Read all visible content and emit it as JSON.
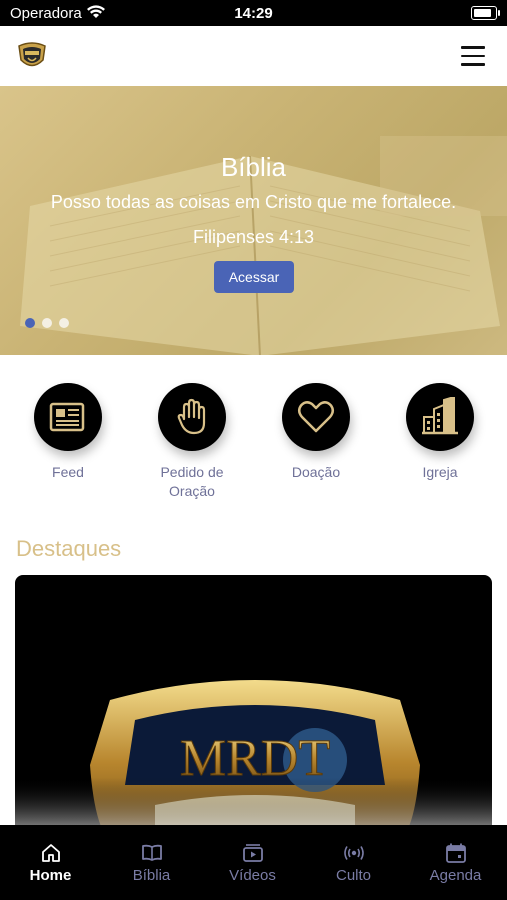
{
  "status_bar": {
    "carrier": "Operadora",
    "time": "14:29"
  },
  "header": {
    "logo_icon": "church-crest-logo",
    "menu_icon": "hamburger-menu-icon"
  },
  "hero": {
    "title": "Bíblia",
    "text": "Posso todas as coisas em Cristo que me fortalece.",
    "reference": "Filipenses 4:13",
    "button_label": "Acessar",
    "slide_count": 3,
    "active_slide": 1
  },
  "quick_actions": [
    {
      "label": "Feed",
      "icon": "newspaper-icon"
    },
    {
      "label": "Pedido de\nOração",
      "icon": "raised-hand-icon"
    },
    {
      "label": "Doação",
      "icon": "heart-icon"
    },
    {
      "label": "Igreja",
      "icon": "buildings-icon"
    }
  ],
  "highlights": {
    "title": "Destaques",
    "card_text": "MRDT"
  },
  "bottom_nav": [
    {
      "label": "Home",
      "icon": "home-icon",
      "active": true
    },
    {
      "label": "Bíblia",
      "icon": "book-icon",
      "active": false
    },
    {
      "label": "Vídeos",
      "icon": "video-icon",
      "active": false
    },
    {
      "label": "Culto",
      "icon": "broadcast-icon",
      "active": false
    },
    {
      "label": "Agenda",
      "icon": "calendar-icon",
      "active": false
    }
  ],
  "colors": {
    "accent": "#4a64b6",
    "gold": "#d8c089",
    "muted_label": "#6f7198"
  }
}
